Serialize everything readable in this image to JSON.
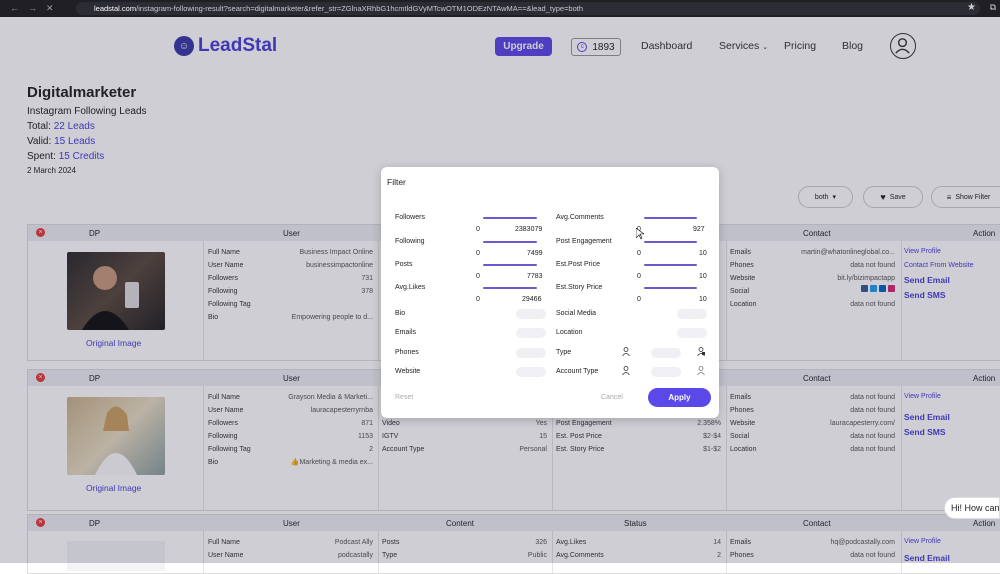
{
  "browser": {
    "url_host": "leadstal.com",
    "url_rest": "/instagram-following-result?search=digitalmarketer&refer_str=ZGlnaXRhbG1hcmtldGVyMTcwOTM1ODEzNTAwMA==&lead_type=both"
  },
  "header": {
    "logo": "LeadStal",
    "upgrade": "Upgrade",
    "credits": "1893",
    "nav": [
      "Dashboard",
      "Services",
      "Pricing",
      "Blog"
    ]
  },
  "summary": {
    "title": "Digitalmarketer",
    "subtitle": "Instagram Following Leads",
    "total_label": "Total:",
    "total_value": "22 Leads",
    "valid_label": "Valid:",
    "valid_value": "15 Leads",
    "spent_label": "Spent:",
    "spent_value": "15 Credits",
    "date": "2 March 2024"
  },
  "tools": {
    "type": "both",
    "save": "Save",
    "show_filter": "Show Filter"
  },
  "columns": [
    "DP",
    "User",
    "Content",
    "Status",
    "Contact",
    "Action"
  ],
  "cards": [
    {
      "user": [
        [
          "Full Name",
          "Business Impact Online"
        ],
        [
          "User Name",
          "businessimpactonline"
        ],
        [
          "Followers",
          "731"
        ],
        [
          "Following",
          "378"
        ],
        [
          "Following Tag",
          ""
        ],
        [
          "Bio",
          "Empowering people to d..."
        ]
      ],
      "contact": [
        [
          "Emails",
          "martin@whatonlineglobal.co..."
        ],
        [
          "Phones",
          "data not found"
        ],
        [
          "Website",
          "bit.ly/bizimpactapp"
        ],
        [
          "Social",
          ""
        ],
        [
          "Location",
          "data not found"
        ]
      ],
      "actions": [
        "View Profile",
        "Contact From Website",
        "Send Email",
        "Send SMS"
      ],
      "original": "Original Image"
    },
    {
      "user": [
        [
          "Full Name",
          "Grayson Media & Marketi..."
        ],
        [
          "User Name",
          "lauracapesterryrnba"
        ],
        [
          "Followers",
          "871"
        ],
        [
          "Following",
          "1153"
        ],
        [
          "Following Tag",
          "2"
        ],
        [
          "Bio",
          "👍Marketing & media ex..."
        ]
      ],
      "content": [
        [
          "Video",
          "Yes"
        ],
        [
          "IGTV",
          "15"
        ],
        [
          "Account Type",
          "Personal"
        ]
      ],
      "status": [
        [
          "Post Engagement",
          "2.358%"
        ],
        [
          "Est. Post Price",
          "$2-$4"
        ],
        [
          "Est. Story Price",
          "$1-$2"
        ]
      ],
      "contact": [
        [
          "Emails",
          "data not found"
        ],
        [
          "Phones",
          "data not found"
        ],
        [
          "Website",
          "lauracapesterry.com/"
        ],
        [
          "Social",
          "data not found"
        ],
        [
          "Location",
          "data not found"
        ]
      ],
      "actions": [
        "View Profile",
        "Send Email",
        "Send SMS"
      ],
      "original": "Original Image"
    },
    {
      "user": [
        [
          "Full Name",
          "Podcast Ally"
        ],
        [
          "User Name",
          "podcastally"
        ]
      ],
      "content": [
        [
          "Posts",
          "326"
        ],
        [
          "Type",
          "Public"
        ]
      ],
      "status": [
        [
          "Avg.Likes",
          "14"
        ],
        [
          "Avg.Comments",
          "2"
        ]
      ],
      "contact": [
        [
          "Emails",
          "hq@podcastally.com"
        ],
        [
          "Phones",
          "data not found"
        ]
      ],
      "actions": [
        "View Profile",
        "Send Email"
      ]
    }
  ],
  "filter": {
    "title": "Filter",
    "ranges": [
      {
        "label": "Followers",
        "min": "0",
        "max": "2383079"
      },
      {
        "label": "Following",
        "min": "0",
        "max": "7499"
      },
      {
        "label": "Posts",
        "min": "0",
        "max": "7783"
      },
      {
        "label": "Avg.Likes",
        "min": "0",
        "max": "29466"
      },
      {
        "label": "Avg.Comments",
        "min": "0",
        "max": "927"
      },
      {
        "label": "Post Engagement",
        "min": "0",
        "max": "10"
      },
      {
        "label": "Est.Post Price",
        "min": "0",
        "max": "10"
      },
      {
        "label": "Est.Story Price",
        "min": "0",
        "max": "10"
      }
    ],
    "toggles_left": [
      "Bio",
      "Emails",
      "Phones",
      "Website"
    ],
    "toggles_right": [
      "Social Media",
      "Location",
      "Type",
      "Account Type"
    ],
    "reset": "Reset",
    "cancel": "Cancel",
    "apply": "Apply"
  },
  "chat": "Hi! How can"
}
